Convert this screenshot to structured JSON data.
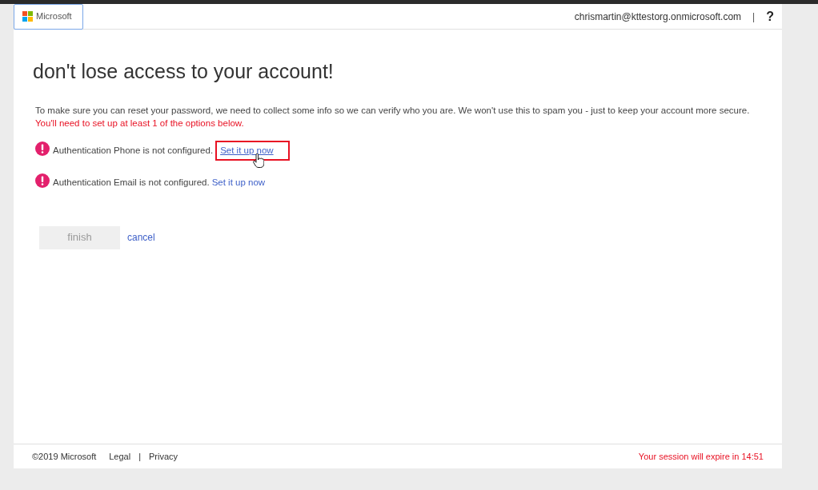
{
  "header": {
    "logo": "Microsoft",
    "user": "chrismartin@kttestorg.onmicrosoft.com",
    "separator": "|",
    "help": "?"
  },
  "title": "don't lose access to your account!",
  "intro": "To make sure you can reset your password, we need to collect some info so we can verify who you are. We won't use this to spam you - just to keep your account more secure.",
  "requirement": "You'll need to set up at least 1 of the options below.",
  "methods": [
    {
      "text": "Authentication Phone is not configured.",
      "link": "Set it up now",
      "highlighted": true
    },
    {
      "text": "Authentication Email is not configured.",
      "link": "Set it up now",
      "highlighted": false
    }
  ],
  "buttons": {
    "finish": {
      "label": "finish",
      "disabled": true
    },
    "cancel": "cancel"
  },
  "footer": {
    "copyright": "©2019 Microsoft",
    "legal": "Legal",
    "separator": "|",
    "privacy": "Privacy",
    "session": "Your session will expire in 14:51"
  }
}
